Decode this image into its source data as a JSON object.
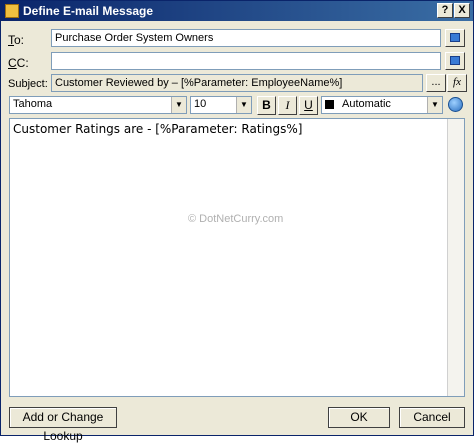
{
  "window": {
    "title": "Define E-mail Message"
  },
  "titlebar": {
    "help": "?",
    "close": "X"
  },
  "to": {
    "label_u": "T",
    "label_rest": "o:",
    "value": "Purchase Order System Owners"
  },
  "cc": {
    "label_u": "C",
    "label_rest": "C:",
    "value": ""
  },
  "subject": {
    "label": "Subject:",
    "value": "Customer Reviewed by – [%Parameter: EmployeeName%]",
    "ellipsis": "...",
    "fx": "fx"
  },
  "format": {
    "font": "Tahoma",
    "size": "10",
    "bold": "B",
    "italic": "I",
    "underline": "U",
    "color_label": "Automatic",
    "color": "#000000",
    "dropdown_arrow": "▼"
  },
  "body": {
    "text": "Customer Ratings are - [%Parameter: Ratings%]",
    "watermark": "© DotNetCurry.com"
  },
  "buttons": {
    "lookup": "Add or Change Lookup",
    "ok": "OK",
    "cancel": "Cancel"
  },
  "colors": {
    "title_start": "#0a246a",
    "title_end": "#3a6ea5",
    "face": "#ece9d8"
  }
}
